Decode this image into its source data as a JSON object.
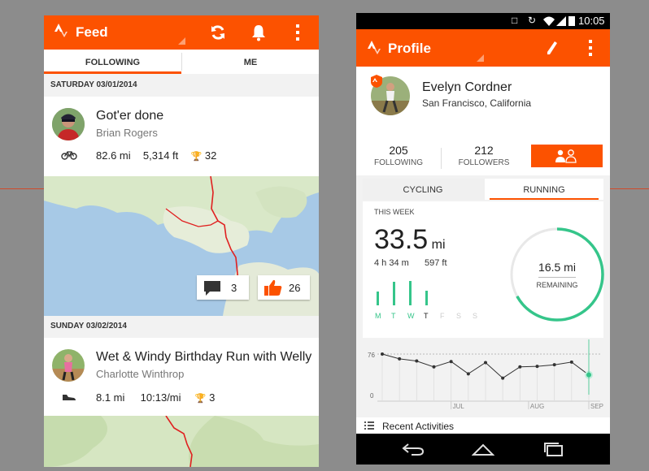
{
  "feed": {
    "title": "Feed",
    "tabs": [
      "FOLLOWING",
      "ME"
    ],
    "activities": [
      {
        "date": "SATURDAY 03/01/2014",
        "title": "Got'er done",
        "athlete": "Brian Rogers",
        "sport_icon": "bike-icon",
        "distance": "82.6 mi",
        "elevation": "5,314 ft",
        "achievements": "32",
        "comments": "3",
        "kudos": "26"
      },
      {
        "date": "SUNDAY 03/02/2014",
        "title": "Wet & Windy Birthday Run with Welly",
        "athlete": "Charlotte Winthrop",
        "sport_icon": "shoe-icon",
        "distance": "8.1 mi",
        "pace": "10:13/mi",
        "achievements": "3"
      }
    ]
  },
  "profile": {
    "status_time": "10:05",
    "title": "Profile",
    "name": "Evelyn Cordner",
    "location": "San Francisco, California",
    "following_count": "205",
    "following_label": "FOLLOWING",
    "followers_count": "212",
    "followers_label": "FOLLOWERS",
    "sport_tabs": [
      "CYCLING",
      "RUNNING"
    ],
    "week_label": "THIS WEEK",
    "distance_value": "33.5",
    "distance_unit": "mi",
    "time": "4 h 34 m",
    "elevation": "597 ft",
    "days": [
      "M",
      "T",
      "W",
      "T",
      "F",
      "S",
      "S"
    ],
    "day_bar_levels": [
      0.55,
      0.95,
      1.0,
      0.6,
      0,
      0,
      0
    ],
    "remaining_value": "16.5 mi",
    "remaining_label": "REMAINING",
    "goal_progress": 0.67,
    "history_y_max_label": "76",
    "history_y_min_label": "0",
    "history_months": [
      "JUL",
      "AUG",
      "SEP"
    ],
    "history_values": [
      76,
      67,
      63,
      52,
      62,
      39,
      60,
      31,
      52,
      53,
      56,
      61,
      37
    ],
    "recent_activities_label": "Recent Activities"
  },
  "colors": {
    "accent": "#fc5200",
    "green": "#35c58a"
  }
}
